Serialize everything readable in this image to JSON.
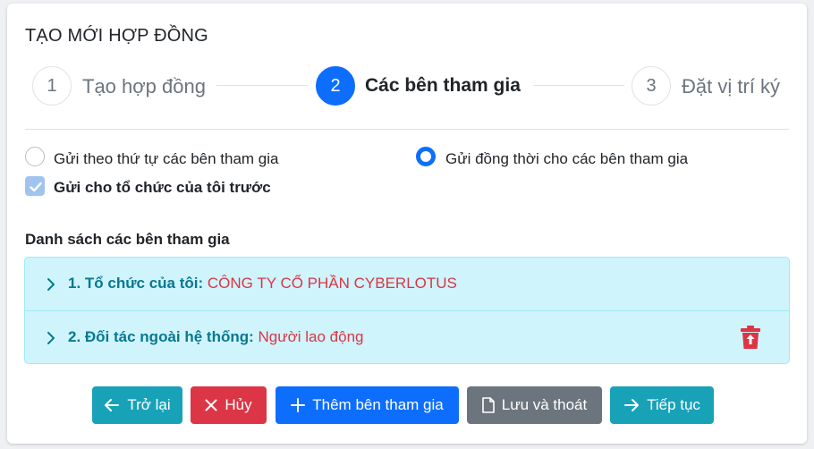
{
  "page": {
    "title": "TẠO MỚI HỢP ĐỒNG"
  },
  "stepper": {
    "steps": [
      {
        "number": "1",
        "label": "Tạo hợp đồng",
        "active": false
      },
      {
        "number": "2",
        "label": "Các bên tham gia",
        "active": true
      },
      {
        "number": "3",
        "label": "Đặt vị trí ký",
        "active": false
      }
    ]
  },
  "options": {
    "sequential_label": "Gửi theo thứ tự các bên tham gia",
    "simultaneous_label": "Gửi đồng thời cho các bên tham gia",
    "selected": "simultaneous",
    "send_org_first_label": "Gửi cho tổ chức của tôi trước",
    "send_org_first_checked": true
  },
  "participants": {
    "title": "Danh sách các bên tham gia",
    "items": [
      {
        "key": "1. Tổ chức của tôi:",
        "value": "CÔNG TY CỔ PHẦN CYBERLOTUS",
        "deletable": false
      },
      {
        "key": "2. Đối tác ngoài hệ thống:",
        "value": "Người lao động",
        "deletable": true
      }
    ]
  },
  "buttons": {
    "back_label": "Trở lại",
    "cancel_label": "Hủy",
    "add_label": "Thêm bên tham gia",
    "save_exit_label": "Lưu và thoát",
    "next_label": "Tiếp tục"
  },
  "colors": {
    "primary": "#0d6efd",
    "info": "#17a2b8",
    "danger": "#dc3545",
    "secondary": "#6c757d",
    "accordion_bg": "#cff4fc"
  },
  "icons": {
    "back": "arrow-left-icon",
    "cancel": "x-icon",
    "add": "plus-icon",
    "save": "file-icon",
    "next": "arrow-right-icon",
    "delete": "trash-icon",
    "expand": "chevron-right-icon"
  }
}
